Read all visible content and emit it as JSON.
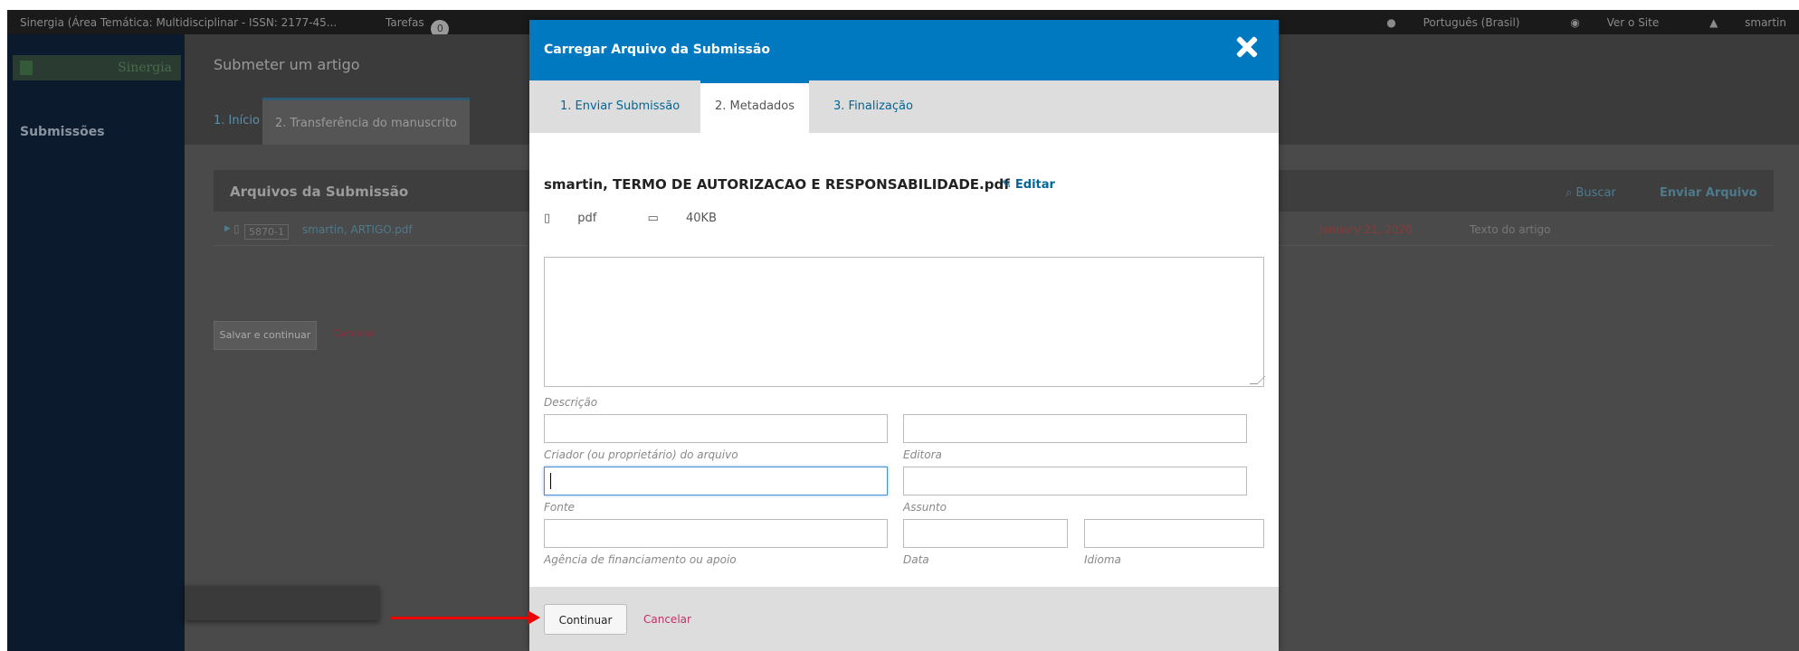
{
  "topbar": {
    "site_title": "Sinergia (Área Temática: Multidisciplinar - ISSN: 2177-45...",
    "tasks_label": "Tarefas",
    "tasks_count": "0",
    "language": "Português (Brasil)",
    "view_site": "Ver o Site",
    "user": "smartin"
  },
  "sidebar": {
    "logo_text": "Sinergia",
    "nav_submissions": "Submissões"
  },
  "main": {
    "page_title": "Submeter um artigo",
    "step1": "1. Início",
    "step2": "2. Transferência do manuscrito",
    "panel_title": "Arquivos da Submissão",
    "search": "Buscar",
    "upload_file": "Enviar Arquivo",
    "file_id": "5870-1",
    "file_name": "smartin, ARTIGO.pdf",
    "file_date": "January 21, 2020",
    "file_type": "Texto do artigo",
    "save_continue": "Salvar e continuar",
    "cancel": "Cancelar"
  },
  "modal": {
    "title": "Carregar Arquivo da Submissão",
    "tabs": [
      "1. Enviar Submissão",
      "2. Metadados",
      "3. Finalização"
    ],
    "file_name": "smartin, TERMO DE AUTORIZACAO E RESPONSABILIDADE.pdf",
    "edit": "Editar",
    "file_format": "pdf",
    "file_size": "40KB",
    "labels": {
      "description": "Descrição",
      "creator": "Criador (ou proprietário) do arquivo",
      "publisher": "Editora",
      "source": "Fonte",
      "subject": "Assunto",
      "sponsor": "Agência de financiamento ou apoio",
      "date": "Data",
      "language": "Idioma"
    },
    "continue": "Continuar",
    "cancel": "Cancelar"
  },
  "colors": {
    "modal_header": "#0079c0",
    "link": "#006798",
    "cancel": "#c0306a",
    "annotation_arrow": "#e00000"
  }
}
